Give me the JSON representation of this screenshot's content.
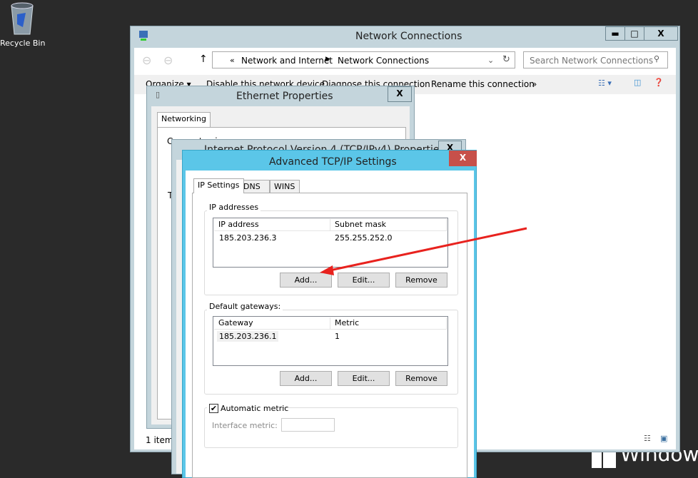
{
  "desktop": {
    "recycle_bin_label": "Recycle Bin",
    "watermark": "Windows"
  },
  "network_window": {
    "title": "Network Connections",
    "breadcrumb": [
      "Network and Internet",
      "Network Connections"
    ],
    "breadcrumb_overflow": "«",
    "search_placeholder": "Search Network Connections",
    "commands": [
      "Organize ▾",
      "Disable this network device",
      "Diagnose this connection",
      "Rename this connection",
      "»"
    ],
    "status": "1 item"
  },
  "ethernet_dialog": {
    "title": "Ethernet Properties",
    "tab": "Networking",
    "partial_label": "Connect using:",
    "partial_letter": "T"
  },
  "ipv4_dialog": {
    "title": "Internet Protocol Version 4 (TCP/IPv4) Properties"
  },
  "advanced_dialog": {
    "title": "Advanced TCP/IP Settings",
    "tabs": [
      "IP Settings",
      "DNS",
      "WINS"
    ],
    "ip_group": {
      "label": "IP addresses",
      "columns": [
        "IP address",
        "Subnet mask"
      ],
      "rows": [
        [
          "185.203.236.3",
          "255.255.252.0"
        ]
      ],
      "buttons": [
        "Add...",
        "Edit...",
        "Remove"
      ]
    },
    "gw_group": {
      "label": "Default gateways:",
      "columns": [
        "Gateway",
        "Metric"
      ],
      "rows": [
        [
          "185.203.236.1",
          "1"
        ]
      ],
      "buttons": [
        "Add...",
        "Edit...",
        "Remove"
      ]
    },
    "metric": {
      "checkbox_label": "Automatic metric",
      "checked": true,
      "interface_metric_label": "Interface metric:",
      "interface_metric_value": ""
    }
  },
  "colors": {
    "accent_titlebar": "#5bc6e8",
    "close_red": "#c7504a",
    "annotation_arrow": "#e8221e"
  }
}
